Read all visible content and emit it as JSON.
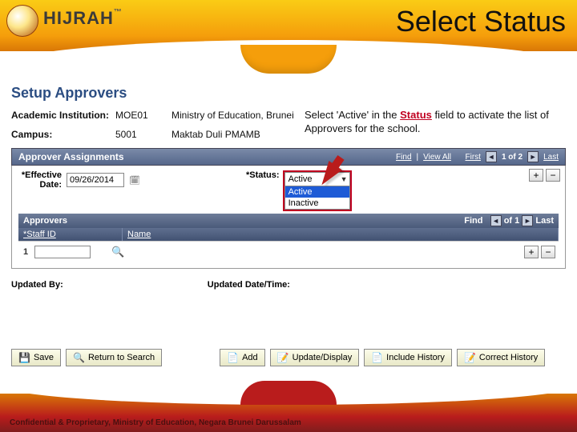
{
  "brand": "HIJRAH",
  "slide_title": "Select Status",
  "page_title": "Setup Approvers",
  "callout_pre": "Select 'Active' in the ",
  "callout_status_word": "Status",
  "callout_post": " field to activate the list of Approvers for the school.",
  "fields": {
    "academic_label": "Academic Institution:",
    "academic_code": "MOE01",
    "academic_name": "Ministry of Education, Brunei",
    "campus_label": "Campus:",
    "campus_code": "5001",
    "campus_name": "Maktab Duli PMAMB"
  },
  "approver_assignments": {
    "title": "Approver Assignments",
    "nav_find": "Find",
    "nav_viewall": "View All",
    "nav_first": "First",
    "nav_last": "Last",
    "nav_page": "1 of 2",
    "eff_label_top": "*Effective",
    "eff_label_bottom": "Date:",
    "eff_value": "09/26/2014",
    "status_label": "*Status:",
    "status_selected": "Active",
    "status_options": [
      "Active",
      "Inactive"
    ]
  },
  "approvers": {
    "title": "Approvers",
    "nav_find": "Find",
    "nav_page": "of 1",
    "nav_last": "Last",
    "col_staff": "*Staff ID",
    "col_name": "Name",
    "row_index": "1"
  },
  "updated_by_label": "Updated By:",
  "updated_dt_label": "Updated Date/Time:",
  "buttons": {
    "save": "Save",
    "return": "Return to Search",
    "add": "Add",
    "update": "Update/Display",
    "include": "Include History",
    "correct": "Correct History"
  },
  "footer": "Confidential & Proprietary, Ministry of Education, Negara Brunei Darussalam"
}
